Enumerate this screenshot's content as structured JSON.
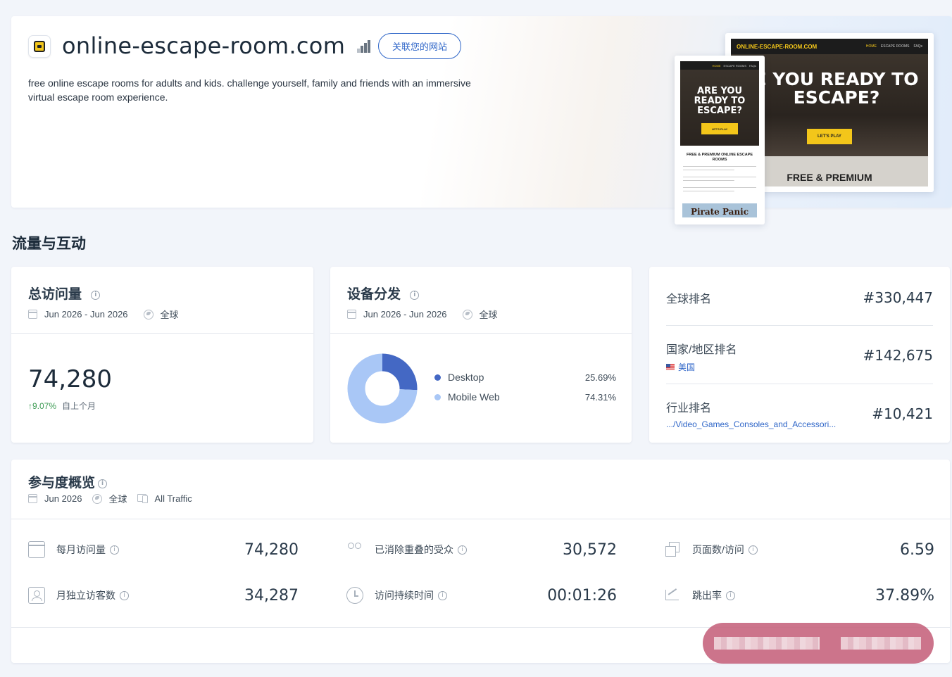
{
  "site": {
    "domain": "online-escape-room.com",
    "connect_label": "关联您的网站",
    "description": "free online escape rooms for adults and kids. challenge yourself, family and friends with an immersive virtual escape room experience."
  },
  "preview_desktop": {
    "brand": "ONLINE-ESCAPE-ROOM.COM",
    "nav": [
      "HOME",
      "ESCAPE ROOMS",
      "FAQs"
    ],
    "headline": "E YOU READY TO ESCAPE?",
    "button": "LET'S PLAY",
    "subheading": "FREE & PREMIUM"
  },
  "preview_mobile": {
    "nav": [
      "HOME",
      "ESCAPE ROOMS",
      "FAQs"
    ],
    "headline": "ARE YOU READY TO ESCAPE?",
    "button": "LET'S PLAY",
    "subheading": "FREE & PREMIUM ONLINE ESCAPE ROOMS",
    "banner": "Pirate Panic"
  },
  "section_title": "流量与互动",
  "total_visits": {
    "title": "总访问量",
    "date_range": "Jun 2026 - Jun 2026",
    "region": "全球",
    "value": "74,280",
    "change": "9.07%",
    "change_label": "自上个月"
  },
  "device_distribution": {
    "title": "设备分发",
    "date_range": "Jun 2026 - Jun 2026",
    "region": "全球",
    "colors": {
      "desktop": "#4468c4",
      "mobile": "#a9c7f6"
    }
  },
  "chart_data": {
    "type": "pie",
    "categories": [
      "Desktop",
      "Mobile Web"
    ],
    "values": [
      25.69,
      74.31
    ],
    "labels": [
      "25.69%",
      "74.31%"
    ]
  },
  "ranks": {
    "global_label": "全球排名",
    "global_value": "#330,447",
    "country_label": "国家/地区排名",
    "country_value": "#142,675",
    "country_name": "美国",
    "industry_label": "行业排名",
    "industry_value": "#10,421",
    "industry_path": ".../Video_Games_Consoles_and_Accessori..."
  },
  "engagement": {
    "title": "参与度概览",
    "date": "Jun 2026",
    "region": "全球",
    "traffic": "All Traffic",
    "metrics": {
      "monthly_visits_label": "每月访问量",
      "monthly_visits_value": "74,280",
      "dedup_audience_label": "已消除重叠的受众",
      "dedup_audience_value": "30,572",
      "pages_per_visit_label": "页面数/访问",
      "pages_per_visit_value": "6.59",
      "unique_visitors_label": "月独立访客数",
      "unique_visitors_value": "34,287",
      "visit_duration_label": "访问持续时间",
      "visit_duration_value": "00:01:26",
      "bounce_rate_label": "跳出率",
      "bounce_rate_value": "37.89%"
    }
  }
}
